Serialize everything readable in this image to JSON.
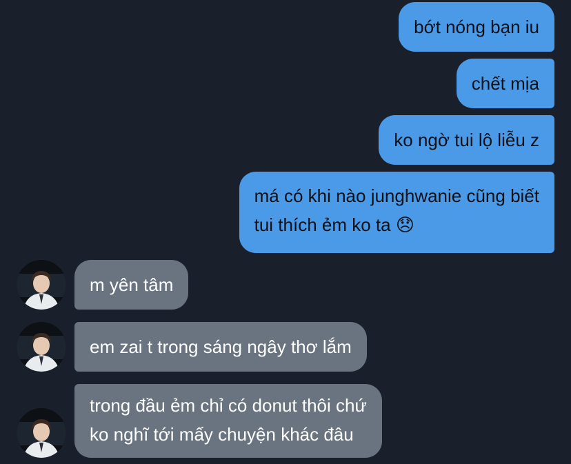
{
  "colors": {
    "background": "#1a202b",
    "outgoing_bubble": "#4a9ae8",
    "incoming_bubble": "#6a7480"
  },
  "messages": [
    {
      "direction": "outgoing",
      "lines": [
        "bớt nóng bạn iu"
      ]
    },
    {
      "direction": "outgoing",
      "lines": [
        "chết mịa"
      ]
    },
    {
      "direction": "outgoing",
      "lines": [
        "ko ngờ tui lộ liễu z"
      ]
    },
    {
      "direction": "outgoing",
      "lines": [
        "má có khi nào junghwanie cũng biết",
        "tui thích ẻm ko ta 😞"
      ]
    },
    {
      "direction": "incoming",
      "lines": [
        "m yên tâm"
      ],
      "avatar": "contact-photo"
    },
    {
      "direction": "incoming",
      "lines": [
        "em zai t trong sáng ngây thơ lắm"
      ],
      "avatar": "contact-photo"
    },
    {
      "direction": "incoming",
      "lines": [
        "trong đầu ẻm chỉ có donut thôi chứ",
        "ko nghĩ tới mấy chuyện khác đâu"
      ],
      "avatar": "contact-photo"
    }
  ]
}
